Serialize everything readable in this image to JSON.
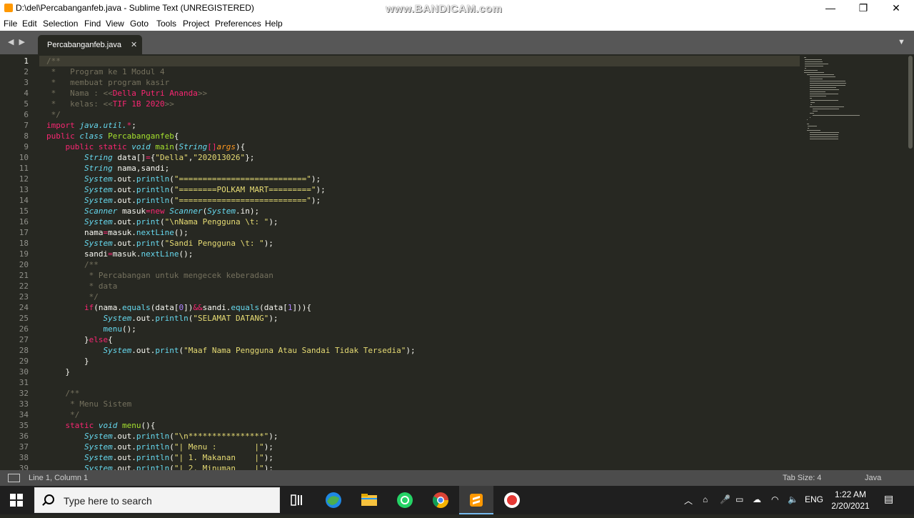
{
  "window": {
    "title": "D:\\del\\Percabanganfeb.java - Sublime Text (UNREGISTERED)",
    "watermark": "www.BANDICAM.com",
    "minimize": "—",
    "maximize": "❐",
    "close": "✕"
  },
  "menu": [
    "File",
    "Edit",
    "Selection",
    "Find",
    "View",
    "Goto",
    "Tools",
    "Project",
    "Preferences",
    "Help"
  ],
  "tabs": {
    "nav": "◀ ▶",
    "active_label": "Percabanganfeb.java",
    "close": "✕",
    "dropdown": "▼"
  },
  "editor": {
    "line_numbers": [
      "1",
      "2",
      "3",
      "4",
      "5",
      "6",
      "7",
      "8",
      "9",
      "10",
      "11",
      "12",
      "13",
      "14",
      "15",
      "16",
      "17",
      "18",
      "19",
      "20",
      "21",
      "22",
      "23",
      "24",
      "25",
      "26",
      "27",
      "28",
      "29",
      "30",
      "31",
      "32",
      "33",
      "34",
      "35",
      "36",
      "37",
      "38",
      "39"
    ],
    "code": [
      [
        [
          "c",
          "/**"
        ]
      ],
      [
        [
          "c",
          " *   Program ke 1 Modul 4"
        ]
      ],
      [
        [
          "c",
          " *   membuat program kasir"
        ]
      ],
      [
        [
          "c",
          " *   Nama : <<"
        ],
        [
          "k",
          "Della Putri Ananda"
        ],
        [
          "c",
          ">>"
        ]
      ],
      [
        [
          "c",
          " *   kelas: <<"
        ],
        [
          "k",
          "TIF 1B 2020"
        ],
        [
          "c",
          ">>"
        ]
      ],
      [
        [
          "c",
          " */"
        ]
      ],
      [
        [
          "k",
          "import "
        ],
        [
          "t",
          "java.util."
        ],
        [
          "k",
          "*"
        ],
        [
          "p",
          ";"
        ]
      ],
      [
        [
          "k",
          "public "
        ],
        [
          "t",
          "class "
        ],
        [
          "g",
          "Percabanganfeb"
        ],
        [
          "p",
          "{"
        ]
      ],
      [
        [
          "p",
          "    "
        ],
        [
          "k",
          "public static "
        ],
        [
          "t",
          "void "
        ],
        [
          "g",
          "main"
        ],
        [
          "p",
          "("
        ],
        [
          "t",
          "String"
        ],
        [
          "k",
          "[]"
        ],
        [
          "o",
          "args"
        ],
        [
          "p",
          "){"
        ]
      ],
      [
        [
          "p",
          "        "
        ],
        [
          "t",
          "String "
        ],
        [
          "p",
          "data[]"
        ],
        [
          "k",
          "="
        ],
        [
          "p",
          "{"
        ],
        [
          "s",
          "\"Della\""
        ],
        [
          "p",
          ","
        ],
        [
          "s",
          "\"202013026\""
        ],
        [
          "p",
          "};"
        ]
      ],
      [
        [
          "p",
          "        "
        ],
        [
          "t",
          "String "
        ],
        [
          "p",
          "nama,sandi;"
        ]
      ],
      [
        [
          "p",
          "        "
        ],
        [
          "t",
          "System"
        ],
        [
          "p",
          ".out."
        ],
        [
          "f",
          "println"
        ],
        [
          "p",
          "("
        ],
        [
          "s",
          "\"===========================\""
        ],
        [
          "p",
          ");"
        ]
      ],
      [
        [
          "p",
          "        "
        ],
        [
          "t",
          "System"
        ],
        [
          "p",
          ".out."
        ],
        [
          "f",
          "println"
        ],
        [
          "p",
          "("
        ],
        [
          "s",
          "\"========POLKAM MART=========\""
        ],
        [
          "p",
          ");"
        ]
      ],
      [
        [
          "p",
          "        "
        ],
        [
          "t",
          "System"
        ],
        [
          "p",
          ".out."
        ],
        [
          "f",
          "println"
        ],
        [
          "p",
          "("
        ],
        [
          "s",
          "\"===========================\""
        ],
        [
          "p",
          ");"
        ]
      ],
      [
        [
          "p",
          "        "
        ],
        [
          "t",
          "Scanner "
        ],
        [
          "p",
          "masuk"
        ],
        [
          "k",
          "=new "
        ],
        [
          "t",
          "Scanner"
        ],
        [
          "p",
          "("
        ],
        [
          "t",
          "System"
        ],
        [
          "p",
          ".in);"
        ]
      ],
      [
        [
          "p",
          "        "
        ],
        [
          "t",
          "System"
        ],
        [
          "p",
          ".out."
        ],
        [
          "f",
          "print"
        ],
        [
          "p",
          "("
        ],
        [
          "s",
          "\"\\nNama Pengguna \\t: \""
        ],
        [
          "p",
          ");"
        ]
      ],
      [
        [
          "p",
          "        nama"
        ],
        [
          "k",
          "="
        ],
        [
          "p",
          "masuk."
        ],
        [
          "f",
          "nextLine"
        ],
        [
          "p",
          "();"
        ]
      ],
      [
        [
          "p",
          "        "
        ],
        [
          "t",
          "System"
        ],
        [
          "p",
          ".out."
        ],
        [
          "f",
          "print"
        ],
        [
          "p",
          "("
        ],
        [
          "s",
          "\"Sandi Pengguna \\t: \""
        ],
        [
          "p",
          ");"
        ]
      ],
      [
        [
          "p",
          "        sandi"
        ],
        [
          "k",
          "="
        ],
        [
          "p",
          "masuk."
        ],
        [
          "f",
          "nextLine"
        ],
        [
          "p",
          "();"
        ]
      ],
      [
        [
          "c",
          "        /**"
        ]
      ],
      [
        [
          "c",
          "         * Percabangan untuk mengecek keberadaan"
        ]
      ],
      [
        [
          "c",
          "         * data"
        ]
      ],
      [
        [
          "c",
          "         */"
        ]
      ],
      [
        [
          "p",
          "        "
        ],
        [
          "k",
          "if"
        ],
        [
          "p",
          "(nama."
        ],
        [
          "f",
          "equals"
        ],
        [
          "p",
          "(data["
        ],
        [
          "n",
          "0"
        ],
        [
          "p",
          "])"
        ],
        [
          "k",
          "&&"
        ],
        [
          "p",
          "sandi."
        ],
        [
          "f",
          "equals"
        ],
        [
          "p",
          "(data["
        ],
        [
          "n",
          "1"
        ],
        [
          "p",
          "])){"
        ]
      ],
      [
        [
          "p",
          "            "
        ],
        [
          "t",
          "System"
        ],
        [
          "p",
          ".out."
        ],
        [
          "f",
          "println"
        ],
        [
          "p",
          "("
        ],
        [
          "s",
          "\"SELAMAT DATANG\""
        ],
        [
          "p",
          ");"
        ]
      ],
      [
        [
          "p",
          "            "
        ],
        [
          "f",
          "menu"
        ],
        [
          "p",
          "();"
        ]
      ],
      [
        [
          "p",
          "        }"
        ],
        [
          "k",
          "else"
        ],
        [
          "p",
          "{"
        ]
      ],
      [
        [
          "p",
          "            "
        ],
        [
          "t",
          "System"
        ],
        [
          "p",
          ".out."
        ],
        [
          "f",
          "print"
        ],
        [
          "p",
          "("
        ],
        [
          "s",
          "\"Maaf Nama Pengguna Atau Sandai Tidak Tersedia\""
        ],
        [
          "p",
          ");"
        ]
      ],
      [
        [
          "p",
          "        }"
        ]
      ],
      [
        [
          "p",
          "    }"
        ]
      ],
      [
        [
          "p",
          ""
        ]
      ],
      [
        [
          "c",
          "    /**"
        ]
      ],
      [
        [
          "c",
          "     * Menu Sistem"
        ]
      ],
      [
        [
          "c",
          "     */"
        ]
      ],
      [
        [
          "p",
          "    "
        ],
        [
          "k",
          "static "
        ],
        [
          "t",
          "void "
        ],
        [
          "g",
          "menu"
        ],
        [
          "p",
          "(){"
        ]
      ],
      [
        [
          "p",
          "        "
        ],
        [
          "t",
          "System"
        ],
        [
          "p",
          ".out."
        ],
        [
          "f",
          "println"
        ],
        [
          "p",
          "("
        ],
        [
          "s",
          "\"\\n****************\""
        ],
        [
          "p",
          ");"
        ]
      ],
      [
        [
          "p",
          "        "
        ],
        [
          "t",
          "System"
        ],
        [
          "p",
          ".out."
        ],
        [
          "f",
          "println"
        ],
        [
          "p",
          "("
        ],
        [
          "s",
          "\"| Menu :        |\""
        ],
        [
          "p",
          ");"
        ]
      ],
      [
        [
          "p",
          "        "
        ],
        [
          "t",
          "System"
        ],
        [
          "p",
          ".out."
        ],
        [
          "f",
          "println"
        ],
        [
          "p",
          "("
        ],
        [
          "s",
          "\"| 1. Makanan    |\""
        ],
        [
          "p",
          ");"
        ]
      ],
      [
        [
          "p",
          "        "
        ],
        [
          "t",
          "System"
        ],
        [
          "p",
          ".out."
        ],
        [
          "f",
          "println"
        ],
        [
          "p",
          "("
        ],
        [
          "s",
          "\"| 2. Minuman    |\""
        ],
        [
          "p",
          ");"
        ]
      ]
    ]
  },
  "status": {
    "position": "Line 1, Column 1",
    "tab_size": "Tab Size: 4",
    "syntax": "Java"
  },
  "taskbar": {
    "search_placeholder": "Type here to search",
    "language": "ENG",
    "time": "1:22 AM",
    "date": "2/20/2021"
  }
}
